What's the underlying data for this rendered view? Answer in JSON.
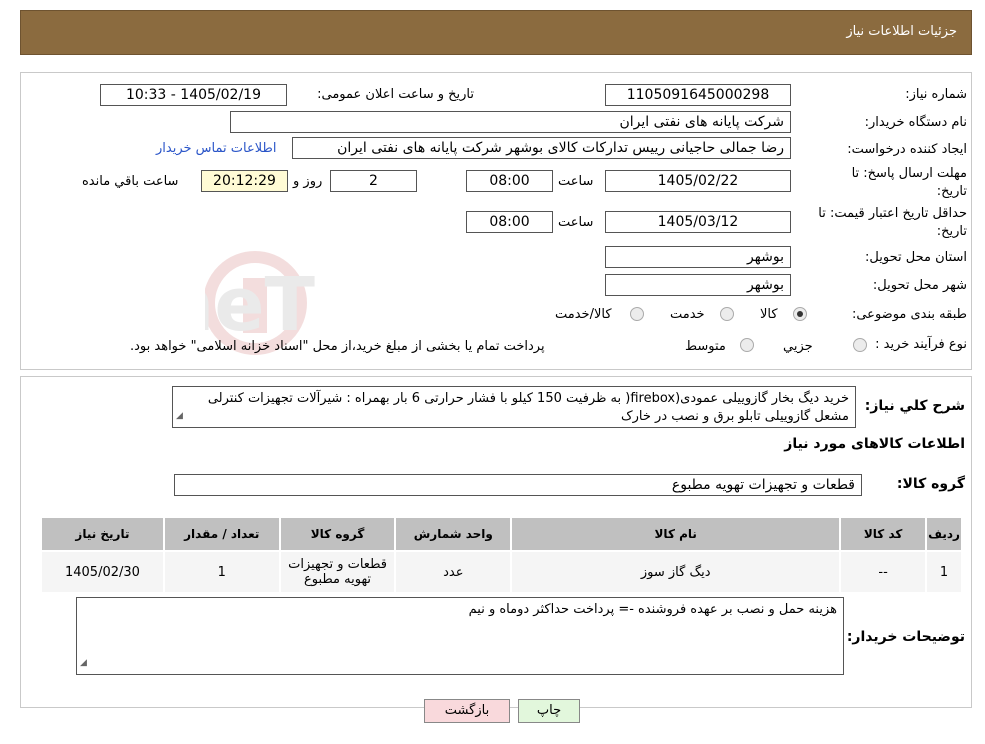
{
  "header": {
    "title": "جزئیات اطلاعات نیاز"
  },
  "form": {
    "need_number_label": "شماره نیاز:",
    "need_number": "1105091645000298",
    "announce_label": "تاریخ و ساعت اعلان عمومی:",
    "announce_value": "1405/02/19 - 10:33",
    "buyer_org_label": "نام دستگاه خریدار:",
    "buyer_org": "شرکت پایانه های نفتی ایران",
    "creator_label": "ایجاد کننده درخواست:",
    "creator": "رضا جمالی حاجیانی رییس تدارکات کالای بوشهر شرکت پایانه های نفتی ایران",
    "contact_link": "اطلاعات تماس خریدار",
    "deadline_label_1": "مهلت ارسال پاسخ: تا",
    "deadline_label_2": "تاریخ:",
    "deadline_date": "1405/02/22",
    "time_label": "ساعت",
    "deadline_time": "08:00",
    "days_value": "2",
    "days_label": "روز و",
    "remaining_time": "20:12:29",
    "remaining_label": "ساعت باقي مانده",
    "validity_label_1": "حداقل تاريخ اعتبار قیمت: تا",
    "validity_label_2": "تاریخ:",
    "validity_date": "1405/03/12",
    "validity_time": "08:00",
    "province_label": "استان محل تحویل:",
    "province": "بوشهر",
    "city_label": "شهر محل تحویل:",
    "city": "بوشهر",
    "category_label": "طبقه بندی موضوعی:",
    "category_options": [
      "کالا",
      "خدمت",
      "کالا/خدمت"
    ],
    "category_selected": "کالا",
    "process_label": "نوع فرآیند خرید :",
    "process_options": [
      "جزیي",
      "متوسط"
    ],
    "process_note": "پرداخت تمام یا بخشی از مبلغ خرید،از محل \"اسناد خزانه اسلامی\" خواهد بود."
  },
  "summary": {
    "label": "شرح کلي نیاز:",
    "text": "خرید دیگ بخار گازوییلی عمودی(firebox( به ظرفیت 150 کیلو با فشار حرارتی 6 بار بهمراه : شیرآلات تجهیزات کنترلی مشعل گازوییلی تابلو برق و نصب در خارک"
  },
  "goods": {
    "section_title": "اطلاعات کالاهای مورد نیاز",
    "group_label": "گروه کالا:",
    "group_value": "قطعات و تجهیزات تهویه مطبوع",
    "columns": [
      "ردیف",
      "کد کالا",
      "نام کالا",
      "واحد شمارش",
      "گروه کالا",
      "تعداد / مقدار",
      "تاریخ نیاز"
    ],
    "rows": [
      {
        "index": "1",
        "code": "--",
        "name": "دیگ گاز سوز",
        "unit": "عدد",
        "group": "قطعات و تجهیزات تهویه مطبوع",
        "qty": "1",
        "date": "1405/02/30"
      }
    ]
  },
  "buyer_notes": {
    "label": "توضیحات خریدار:",
    "text": "هزینه حمل و نصب بر عهده فروشنده -= پرداخت حداکثر دوماه و نیم"
  },
  "buttons": {
    "print": "چاپ",
    "back": "بازگشت"
  },
  "watermark_text": "AriaTender.neT",
  "colors": {
    "header_bg": "#8b6b3f",
    "table_header": "#c0c0c0",
    "link": "#2a55c8",
    "back_button": "#f9d9dc",
    "print_button": "#e2f7dc"
  }
}
